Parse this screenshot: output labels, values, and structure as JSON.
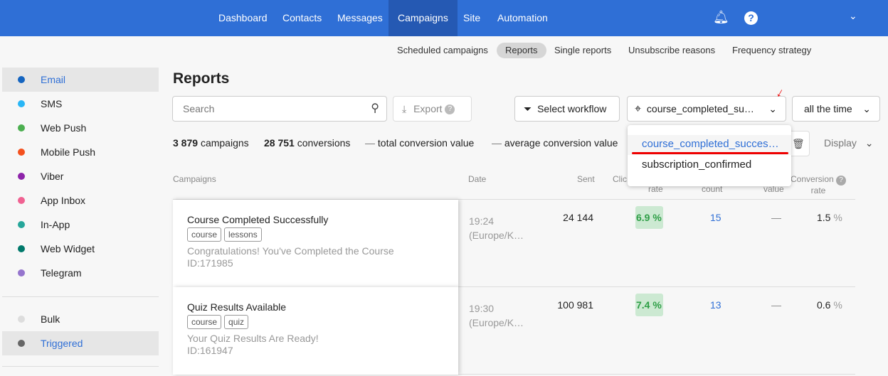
{
  "nav": {
    "items": [
      "Dashboard",
      "Contacts",
      "Messages",
      "Campaigns",
      "Site",
      "Automation"
    ],
    "active": "Campaigns"
  },
  "subnav": {
    "items": [
      "Scheduled campaigns",
      "Reports",
      "Single reports",
      "Unsubscribe reasons",
      "Frequency strategy"
    ],
    "active": "Reports"
  },
  "sidebar": {
    "channels": [
      {
        "label": "Email",
        "color": "#1565c0"
      },
      {
        "label": "SMS",
        "color": "#29b6f6"
      },
      {
        "label": "Web Push",
        "color": "#4caf50"
      },
      {
        "label": "Mobile Push",
        "color": "#f4511e"
      },
      {
        "label": "Viber",
        "color": "#8e24aa"
      },
      {
        "label": "App Inbox",
        "color": "#f06292"
      },
      {
        "label": "In-App",
        "color": "#26a69a"
      },
      {
        "label": "Web Widget",
        "color": "#00796b"
      },
      {
        "label": "Telegram",
        "color": "#9575cd"
      }
    ],
    "types": [
      {
        "label": "Bulk",
        "color": "#ddd"
      },
      {
        "label": "Triggered",
        "color": "#666"
      }
    ]
  },
  "page": {
    "title": "Reports"
  },
  "toolbar": {
    "search_placeholder": "Search",
    "export": "Export",
    "select_workflow": "Select workflow",
    "event_select": "course_completed_su…",
    "period": "all the time",
    "display": "Display"
  },
  "stats": {
    "campaigns_value": "3 879",
    "campaigns_label": "campaigns",
    "conversions_value": "28 751",
    "conversions_label": "conversions",
    "total_value": "total conversion value",
    "average_value": "average conversion value",
    "dash": "—"
  },
  "dropdown": {
    "options": [
      "course_completed_succes…",
      "subscription_confirmed"
    ],
    "selected": 0
  },
  "table": {
    "headers": {
      "campaigns": "Campaigns",
      "date": "Date",
      "sent": "Sent",
      "clicks": "Clic",
      "rate": "rate",
      "count": "count",
      "value": "value",
      "conv_rate_1": "Conversion",
      "conv_rate_2": "rate"
    },
    "rows": [
      {
        "name": "Course Completed Successfully",
        "tags": [
          "course",
          "lessons"
        ],
        "subject": "Congratulations! You've Completed the Course",
        "id": "ID:171985",
        "time": "19:24",
        "tz": "(Europe/K…",
        "sent": "24 144",
        "click_rate": "6.9 %",
        "count": "15",
        "value": "—",
        "conv_rate": "1.5",
        "pct": "%"
      },
      {
        "name": "Quiz Results Available",
        "tags": [
          "course",
          "quiz"
        ],
        "subject": "Your Quiz Results Are Ready!",
        "id": "ID:161947",
        "time": "19:30",
        "tz": "(Europe/K…",
        "sent": "100 981",
        "click_rate": "7.4 %",
        "count": "13",
        "value": "—",
        "conv_rate": "0.6",
        "pct": "%"
      }
    ]
  }
}
